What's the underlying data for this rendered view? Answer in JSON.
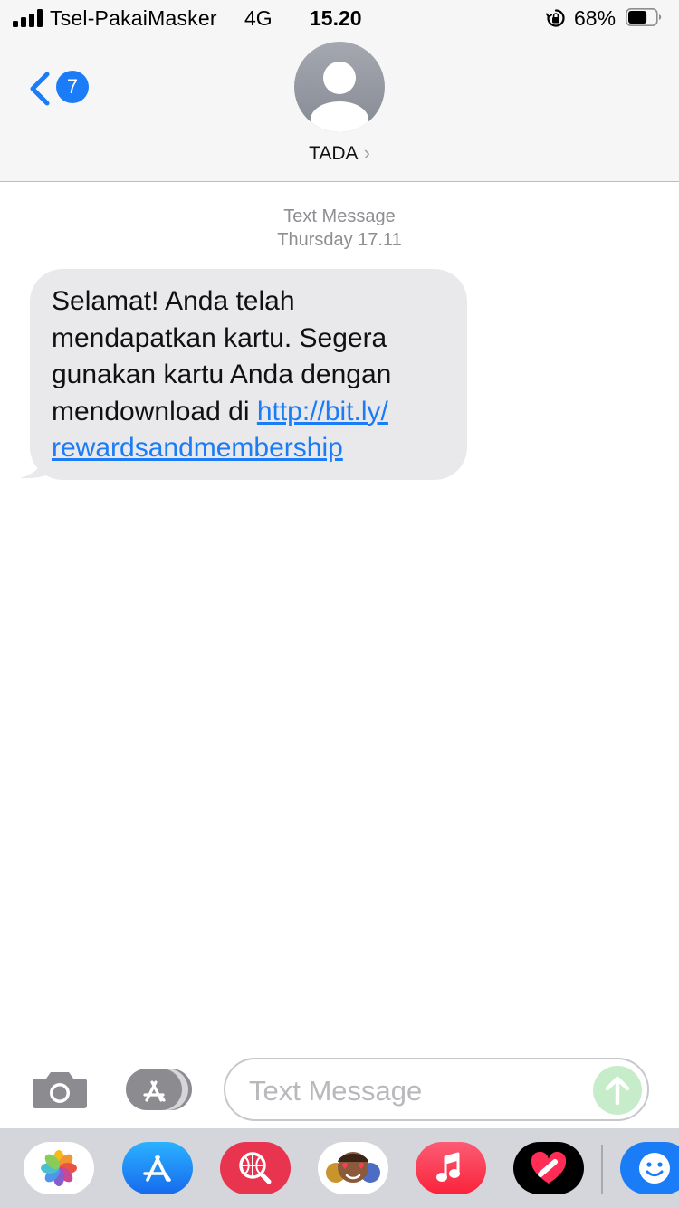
{
  "status_bar": {
    "carrier": "Tsel-PakaiMasker",
    "network": "4G",
    "time": "15.20",
    "battery_percent": "68%",
    "battery_level": 0.68,
    "icons": [
      "signal-icon",
      "orientation-lock-icon",
      "battery-icon"
    ]
  },
  "header": {
    "back_badge": "7",
    "contact_name": "TADA",
    "contact_chevron": "›"
  },
  "conversation": {
    "service_label": "Text Message",
    "timestamp": "Thursday 17.11",
    "messages": [
      {
        "direction": "incoming",
        "text": "Selamat! Anda telah mendapatkan kartu. Segera gunakan kartu Anda dengan mendownload di ",
        "link_line1": "http://bit.ly/",
        "link_line2": "rewardsandmembership"
      }
    ]
  },
  "composer": {
    "placeholder": "Text Message",
    "value": ""
  },
  "app_strip": {
    "apps": [
      "photos-app-icon",
      "app-store-icon",
      "web-search-icon",
      "memoji-stickers-icon",
      "music-icon",
      "digital-touch-icon",
      "emoji-icon"
    ]
  },
  "colors": {
    "accent_blue": "#1a7cf6",
    "bubble_gray": "#e9e9eb",
    "bar_gray": "#f6f6f6",
    "send_disabled": "#c6ecc9"
  }
}
